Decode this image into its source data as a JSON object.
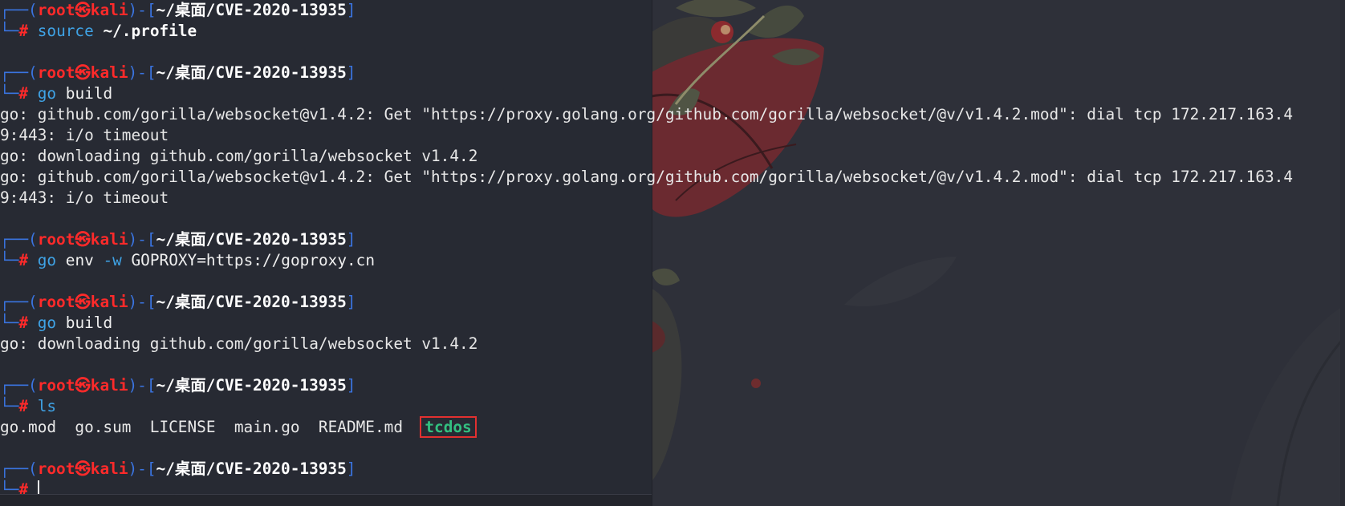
{
  "prompt": {
    "open_top": "┌──(",
    "user": "root",
    "skull": "㉿",
    "host": "kali",
    "mid": ")-[",
    "path": "~/桌面/CVE-2020-13935",
    "close": "]",
    "corner": "└─",
    "hash": "#"
  },
  "blocks": [
    {
      "cmd": "source",
      "arg": " ~/.profile"
    },
    {
      "cmd": "go",
      "arg": " build"
    },
    {
      "cmd": "go",
      "arg": " env",
      "flag": " -w",
      "arg2": " GOPROXY=https://goproxy.cn"
    },
    {
      "cmd": "go",
      "arg": " build"
    },
    {
      "cmd": "ls",
      "arg": ""
    }
  ],
  "outputs": {
    "build1": [
      "go: github.com/gorilla/websocket@v1.4.2: Get \"https://proxy.golang.org/github.com/gorilla/websocket/@v/v1.4.2.mod\": dial tcp 172.217.163.4",
      "9:443: i/o timeout",
      "go: downloading github.com/gorilla/websocket v1.4.2",
      "go: github.com/gorilla/websocket@v1.4.2: Get \"https://proxy.golang.org/github.com/gorilla/websocket/@v/v1.4.2.mod\": dial tcp 172.217.163.4",
      "9:443: i/o timeout"
    ],
    "build2": [
      "go: downloading github.com/gorilla/websocket v1.4.2"
    ],
    "ls_files": "go.mod  go.sum  LICENSE  main.go  README.md  ",
    "ls_exec": "tcdos"
  },
  "colors": {
    "prompt_red": "#ff2a2a",
    "prompt_blue": "#3a74e0",
    "command_blue": "#3fa3e6",
    "exec_green": "#33c080",
    "highlight_box": "#e23030",
    "terminal_bg": "#272a33"
  }
}
